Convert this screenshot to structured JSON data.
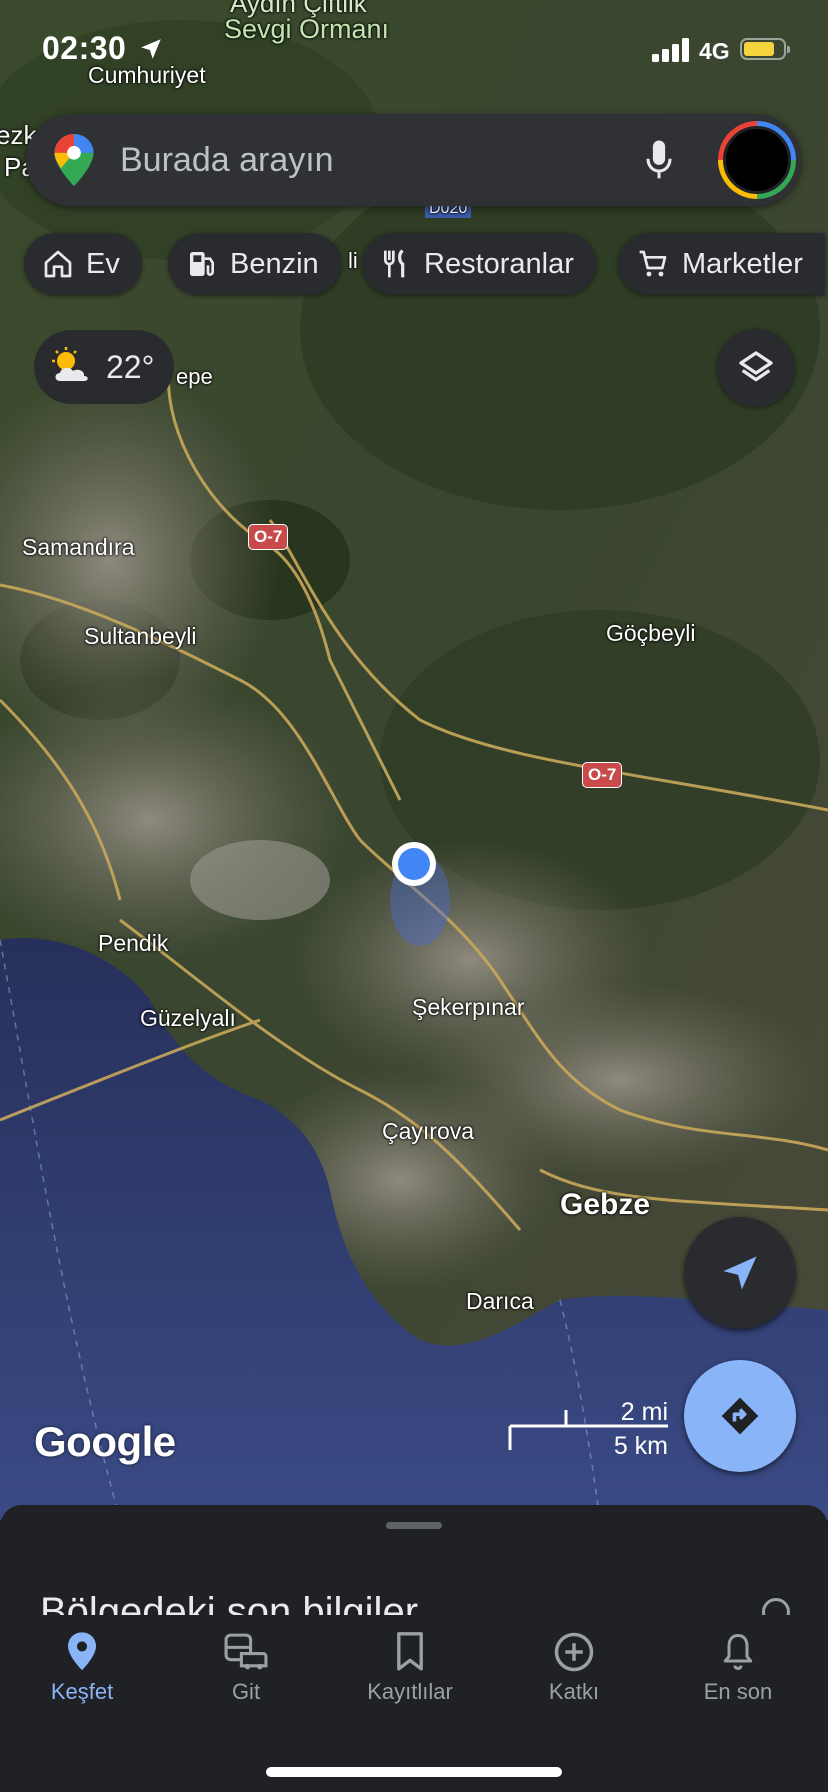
{
  "status_bar": {
    "time": "02:30",
    "network": "4G",
    "icons": [
      "location-arrow-icon",
      "signal-icon",
      "battery-icon"
    ]
  },
  "search": {
    "placeholder": "Burada arayın",
    "icons": [
      "maps-pin-icon",
      "mic-icon",
      "account-avatar"
    ]
  },
  "chips": [
    {
      "label": "Ev",
      "icon": "home-icon"
    },
    {
      "label": "Benzin",
      "icon": "gas-station-icon"
    },
    {
      "label": "Restoranlar",
      "icon": "restaurant-icon"
    },
    {
      "label": "Marketler",
      "icon": "shopping-cart-icon"
    }
  ],
  "weather": {
    "temperature": "22°",
    "icon": "partly-cloudy-icon"
  },
  "map": {
    "labels": {
      "top_area": "Aydın Çiftlik",
      "forest": "Sevgi Ormanı",
      "cumhuriyet": "Cumhuriyet",
      "samandira": "Samandıra",
      "sultanbeyli": "Sultanbeyli",
      "gocbeyli": "Göçbeyli",
      "pendik": "Pendik",
      "guzelyali": "Güzelyalı",
      "sekerpinar": "Şekerpınar",
      "cayirova": "Çayırova",
      "gebze": "Gebze",
      "darica": "Darıca",
      "partial_left1": "ezk",
      "partial_left2": "Pa",
      "partial_tepe": "epe",
      "partial_road": "D020",
      "partial_li": "li"
    },
    "road_shields": {
      "o7_a": "O-7",
      "o7_b": "O-7"
    },
    "attribution": "Google",
    "scale": {
      "imperial": "2 mi",
      "metric": "5 km"
    },
    "controls": [
      "layers-icon",
      "my-location-icon",
      "directions-icon"
    ]
  },
  "sheet": {
    "title": "Bölgedeki son bilgiler"
  },
  "nav": [
    {
      "label": "Keşfet",
      "icon": "explore-pin-icon",
      "active": true
    },
    {
      "label": "Git",
      "icon": "commute-icon",
      "active": false
    },
    {
      "label": "Kayıtlılar",
      "icon": "bookmark-icon",
      "active": false
    },
    {
      "label": "Katkı",
      "icon": "add-circle-icon",
      "active": false
    },
    {
      "label": "En son",
      "icon": "bell-icon",
      "active": false
    }
  ],
  "colors": {
    "accent": "#8ab4f8",
    "surface": "#202124",
    "chip": "#2a2b2e"
  }
}
